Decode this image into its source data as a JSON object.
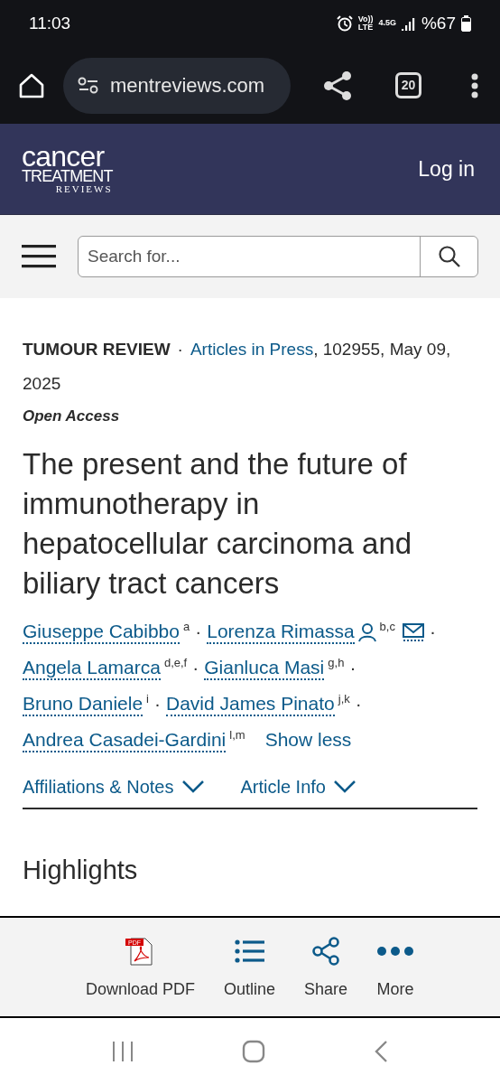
{
  "status_bar": {
    "time": "11:03",
    "volte": "Vo))",
    "lte": "LTE",
    "network": "4.5G",
    "battery": "%67"
  },
  "browser": {
    "url": "mentreviews.com",
    "tab_count": "20"
  },
  "header": {
    "logo": {
      "line_1": "cancer",
      "line_2": "TREATMENT",
      "line_3": "REVIEWS"
    },
    "login": "Log in"
  },
  "search": {
    "placeholder": "Search for..."
  },
  "article": {
    "section": "TUMOUR REVIEW",
    "separator": "·",
    "issue_link": "Articles in Press",
    "details": ", 102955, May 09, 2025",
    "access": "Open Access",
    "title": "The present and the future of immunotherapy in hepatocellular carcinoma and biliary tract cancers",
    "authors": [
      {
        "name": "Giuseppe Cabibbo",
        "marks": "a",
        "corresponding": false,
        "separator": "·"
      },
      {
        "name": "Lorenza Rimassa",
        "marks": "b,c",
        "corresponding": true,
        "separator": "·"
      },
      {
        "name": "Angela Lamarca",
        "marks": "d,e,f",
        "corresponding": false,
        "separator": "·"
      },
      {
        "name": "Gianluca Masi",
        "marks": "g,h",
        "corresponding": false,
        "separator": "·"
      },
      {
        "name": "Bruno Daniele",
        "marks": "i",
        "corresponding": false,
        "separator": "·"
      },
      {
        "name": "David James Pinato",
        "marks": "j,k",
        "corresponding": false,
        "separator": "·"
      },
      {
        "name": "Andrea Casadei-Gardini",
        "marks": "l,m",
        "corresponding": false
      }
    ],
    "show_less": "Show less",
    "disclosures": [
      {
        "label": "Affiliations & Notes",
        "expanded": false
      },
      {
        "label": "Article Info",
        "expanded": false
      }
    ],
    "heading": "Highlights"
  },
  "toolbar": [
    {
      "kind": "pdf",
      "label": "Download PDF",
      "icon_text": "PDF"
    },
    {
      "kind": "outline",
      "label": "Outline"
    },
    {
      "kind": "share",
      "label": "Share"
    },
    {
      "kind": "more",
      "label": "More"
    }
  ]
}
